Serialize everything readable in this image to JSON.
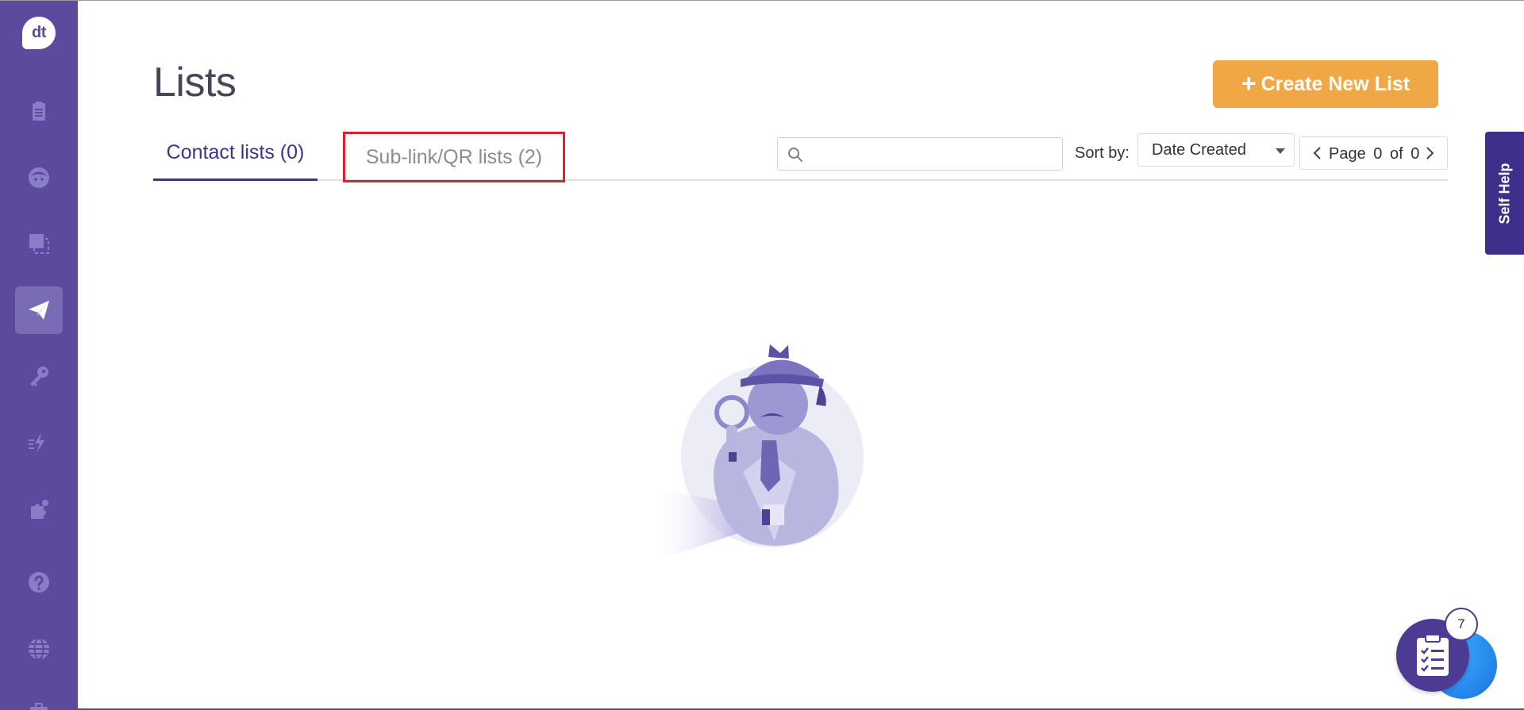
{
  "sidebar": {
    "logo_text": "dt",
    "items": [
      {
        "icon": "clipboard-icon",
        "active": false
      },
      {
        "icon": "face-icon",
        "active": false
      },
      {
        "icon": "layers-icon",
        "active": false
      },
      {
        "icon": "paper-plane-icon",
        "active": true
      },
      {
        "icon": "key-icon",
        "active": false
      },
      {
        "icon": "lightning-icon",
        "active": false
      },
      {
        "icon": "puzzle-icon",
        "active": false
      },
      {
        "icon": "help-icon",
        "active": false
      },
      {
        "icon": "globe-icon",
        "active": false
      },
      {
        "icon": "briefcase-icon",
        "active": false
      }
    ]
  },
  "header": {
    "title": "Lists",
    "create_button_label": "Create New List",
    "create_button_color": "#f0a846"
  },
  "tabs": [
    {
      "label": "Contact lists (0)",
      "active": true
    },
    {
      "label": "Sub-link/QR lists (2)",
      "active": false,
      "highlighted": true
    }
  ],
  "toolbar": {
    "search_value": "",
    "search_placeholder": "",
    "sort_label": "Sort by:",
    "sort_value": "Date Created",
    "page_label": "Page",
    "page_current": "0",
    "page_of": "of",
    "page_total": "0"
  },
  "self_help": {
    "label": "Self Help"
  },
  "widgets": {
    "task_badge_count": "7"
  },
  "colors": {
    "sidebar": "#5c4a9e",
    "accent": "#3a3490",
    "highlight_border": "#e0202a"
  }
}
